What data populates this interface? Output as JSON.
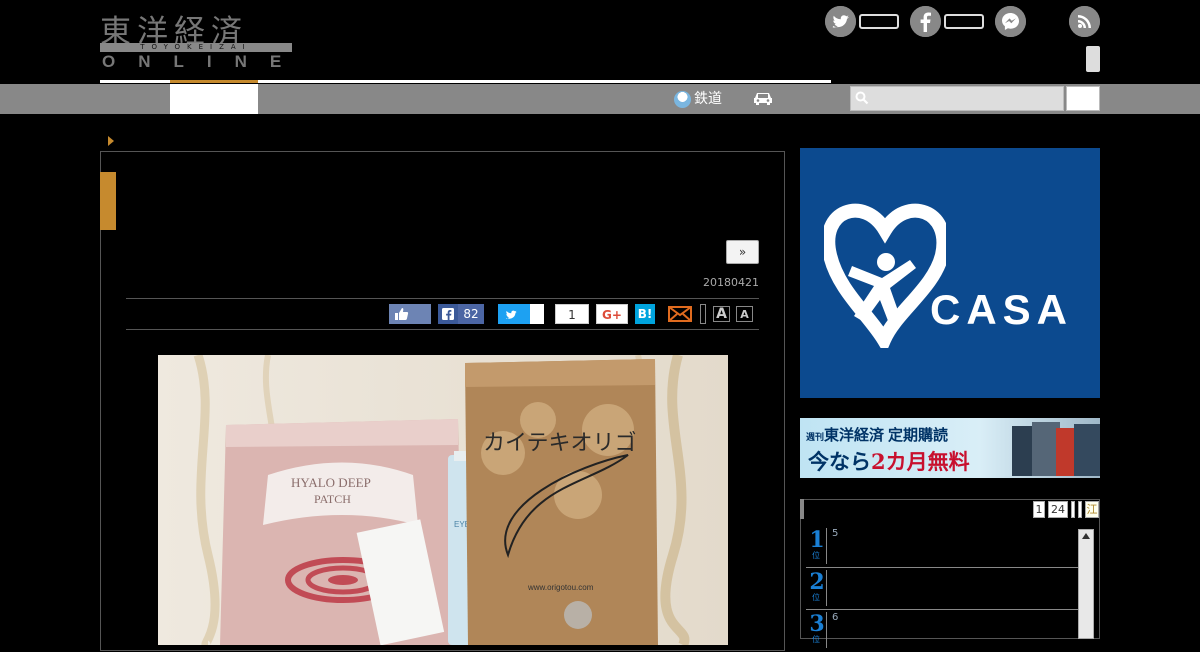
{
  "site": {
    "logo_kanji": "東洋経済",
    "logo_romaji": "TOYOKEIZAI",
    "logo_online": "ONLINE"
  },
  "social": {
    "twitter": "twitter-icon",
    "facebook": "facebook-icon",
    "messenger": "messenger-icon",
    "rss": "rss-icon"
  },
  "nav": {
    "rail_label": "鉄道",
    "search_placeholder": ""
  },
  "article": {
    "next_label": "»",
    "date": "20180421",
    "share": {
      "facebook_count": "82",
      "pocket_count": "1",
      "gplus_label": "G+",
      "hatena_label": "B!"
    },
    "font_small": "A",
    "font_large": "A"
  },
  "photo": {
    "product1_line1": "HYALO DEEP",
    "product1_line2": "PATCH",
    "product2": "EYE KIRARI",
    "product3_title": "カイテキオリゴ",
    "product3_url": "www.origotou.com"
  },
  "sidebar": {
    "ad_brand": "CASA",
    "sub_line1_prefix": "週刊",
    "sub_line1_brand": "東洋経済",
    "sub_line1_suffix": "定期購読",
    "sub_line2_prefix": "今なら",
    "sub_line2_red": "2カ月無料",
    "rank_tabs": [
      "1",
      "24"
    ],
    "rank_tab_last": "江",
    "ranks": [
      {
        "num": "1",
        "suffix": "位",
        "text": "5"
      },
      {
        "num": "2",
        "suffix": "位",
        "text": ""
      },
      {
        "num": "3",
        "suffix": "位",
        "text": "6"
      }
    ]
  }
}
